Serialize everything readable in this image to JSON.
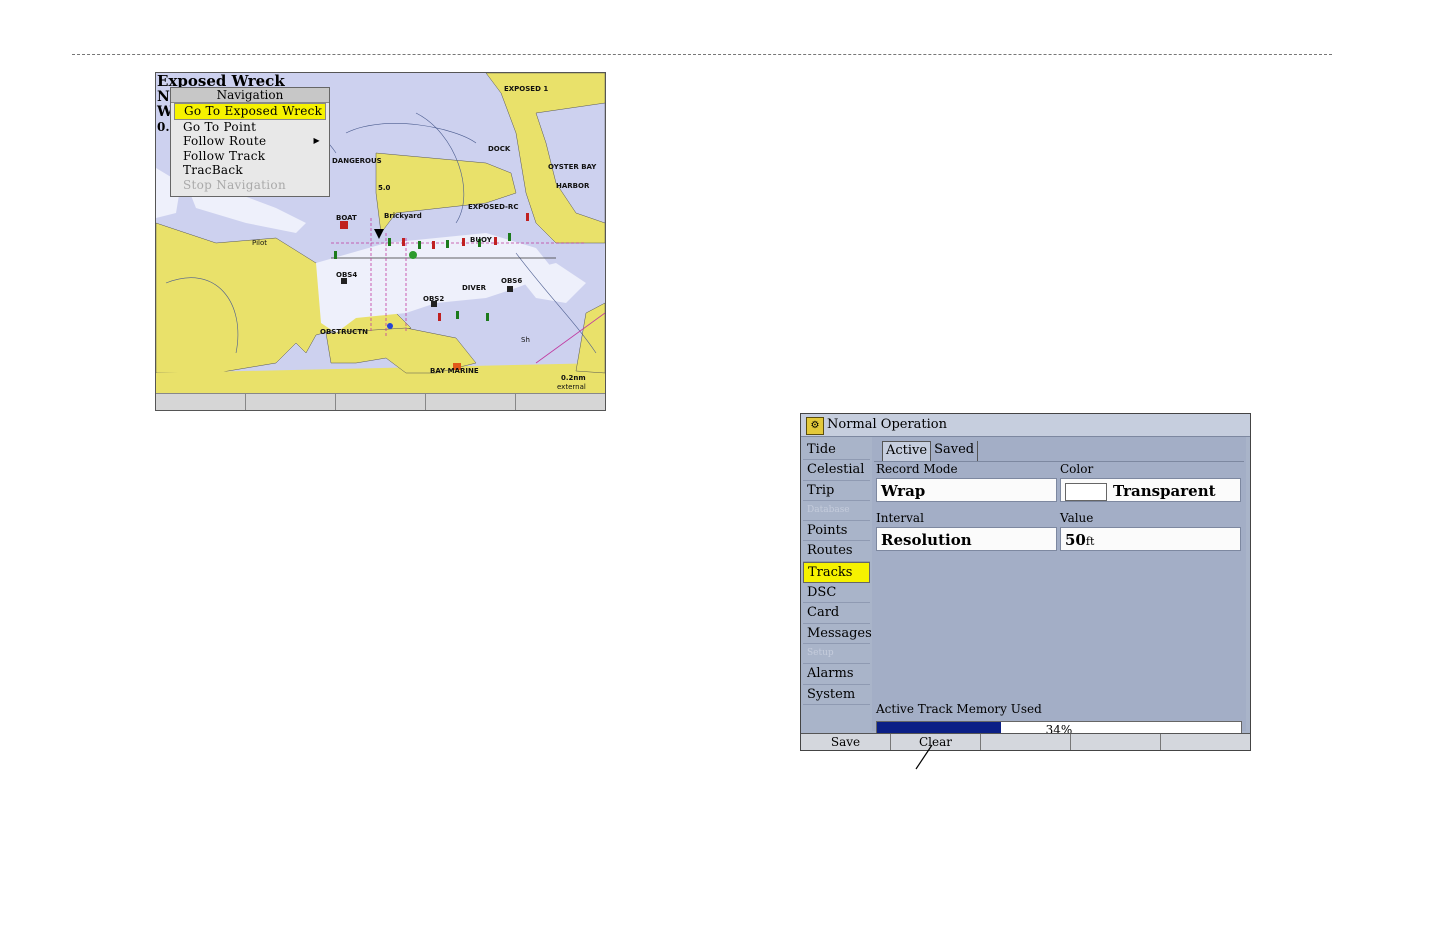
{
  "map_screen": {
    "title": "Exposed Wreck",
    "side_letters": [
      "N",
      "W",
      "0."
    ],
    "menu": {
      "header": "Navigation",
      "items": [
        {
          "label": "Go To Exposed Wreck",
          "selected": true,
          "disabled": false
        },
        {
          "label": "Go To Point",
          "selected": false,
          "disabled": false
        },
        {
          "label": "Follow Route",
          "selected": false,
          "disabled": false,
          "submenu": true
        },
        {
          "label": "Follow Track",
          "selected": false,
          "disabled": false
        },
        {
          "label": "TracBack",
          "selected": false,
          "disabled": false
        },
        {
          "label": "Stop Navigation",
          "selected": false,
          "disabled": true
        }
      ],
      "submenu_arrow": "▶"
    },
    "labels": {
      "exposed_1": "EXPOSED 1",
      "dangerous": "DANGEROUS",
      "dock": "DOCK",
      "oyster_bay": "OYSTER BAY",
      "harbor": "HARBOR",
      "depth_50": "5.0",
      "boat": "BOAT",
      "brickyard": "Brickyard",
      "exposed_rc": "EXPOSED-RC",
      "buoy": "BUOY",
      "pilot": "Pilot",
      "obs1": "OBS4",
      "obs2": "OBS2",
      "obs3": "OBS6",
      "diver": "DIVER",
      "obstructn": "OBSTRUCTN",
      "bay_marine": "BAY MARINE",
      "scale": "0.2nm",
      "scale_sub": "external",
      "sh": "Sh"
    },
    "softkeys": [
      "",
      "",
      "",
      "",
      ""
    ],
    "colors": {
      "land": "#e9e16a",
      "water_deep": "#cdd1ef",
      "water_shallow": "#eef0fb",
      "highlight": "#f6f200"
    }
  },
  "tracks_screen": {
    "title": "Normal Operation",
    "sidebar": [
      {
        "label": "Tide",
        "selected": false,
        "disabled": false
      },
      {
        "label": "Celestial",
        "selected": false,
        "disabled": false
      },
      {
        "label": "Trip",
        "selected": false,
        "disabled": false
      },
      {
        "label": "Database",
        "selected": false,
        "disabled": true
      },
      {
        "label": "Points",
        "selected": false,
        "disabled": false
      },
      {
        "label": "Routes",
        "selected": false,
        "disabled": false
      },
      {
        "label": "Tracks",
        "selected": true,
        "disabled": false
      },
      {
        "label": "DSC",
        "selected": false,
        "disabled": false
      },
      {
        "label": "Card",
        "selected": false,
        "disabled": false
      },
      {
        "label": "Messages",
        "selected": false,
        "disabled": false
      },
      {
        "label": "Setup",
        "selected": false,
        "disabled": true
      },
      {
        "label": "Alarms",
        "selected": false,
        "disabled": false
      },
      {
        "label": "System",
        "selected": false,
        "disabled": false
      }
    ],
    "tabs": [
      {
        "label": "Active",
        "active": true
      },
      {
        "label": "Saved",
        "active": false
      }
    ],
    "record_mode": {
      "label": "Record Mode",
      "value": "Wrap"
    },
    "color": {
      "label": "Color",
      "value": "Transparent"
    },
    "interval": {
      "label": "Interval",
      "value": "Resolution"
    },
    "value": {
      "label": "Value",
      "value": "50",
      "unit": "ft"
    },
    "memory": {
      "label": "Active Track Memory Used",
      "percent_text": "34%",
      "fraction": 0.34
    },
    "softkeys": [
      "Save",
      "Clear",
      "",
      "",
      ""
    ],
    "colors": {
      "progress_fill": "#0b1f86",
      "highlight": "#f6f200"
    }
  }
}
